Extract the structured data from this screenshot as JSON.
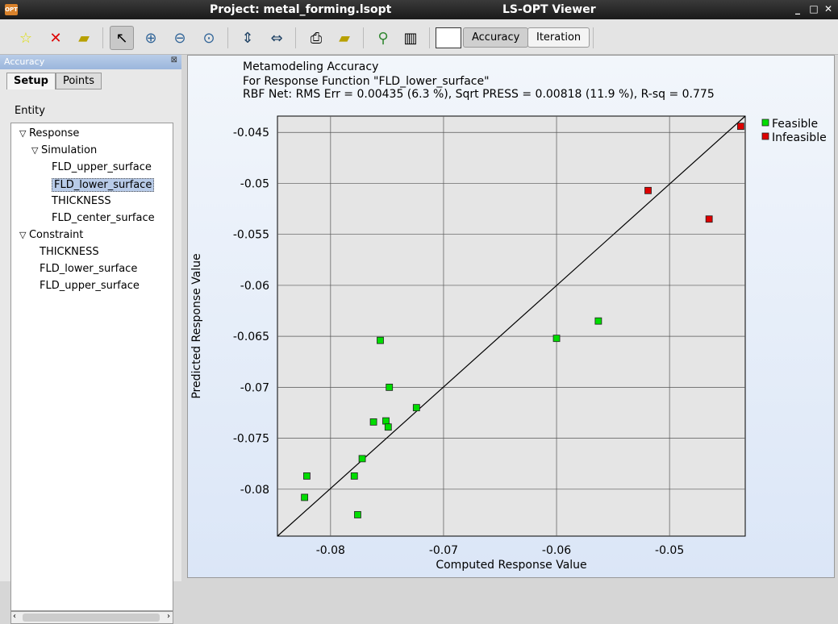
{
  "window": {
    "project_title": "Project: metal_forming.lsopt",
    "app_title": "LS-OPT Viewer",
    "app_icon_text": "OPT"
  },
  "toolbar": {
    "accuracy_label": "Accuracy",
    "iteration_label": "Iteration"
  },
  "left_panel": {
    "title": "Accuracy",
    "tabs": [
      "Setup",
      "Points"
    ],
    "entity_label": "Entity",
    "tree": [
      {
        "label": "Response",
        "level": 0,
        "expander": true
      },
      {
        "label": "Simulation",
        "level": 1,
        "expander": true
      },
      {
        "label": "FLD_upper_surface",
        "level": 2
      },
      {
        "label": "FLD_lower_surface",
        "level": 2,
        "selected": true
      },
      {
        "label": "THICKNESS",
        "level": 2
      },
      {
        "label": "FLD_center_surface",
        "level": 2
      },
      {
        "label": "Constraint",
        "level": 0,
        "expander": true
      },
      {
        "label": "THICKNESS",
        "level": 1
      },
      {
        "label": "FLD_lower_surface",
        "level": 1
      },
      {
        "label": "FLD_upper_surface",
        "level": 1
      }
    ]
  },
  "plot": {
    "title1": "Metamodeling Accuracy",
    "title2": "For Response Function \"FLD_lower_surface\"",
    "title3": "RBF Net: RMS Err = 0.00435 (6.3   %),  Sqrt PRESS = 0.00818 (11.9  %),  R-sq = 0.775"
  },
  "chart_data": {
    "type": "scatter",
    "xlabel": "Computed Response Value",
    "ylabel": "Predicted Response Value",
    "xlim": [
      -0.0847,
      -0.0433
    ],
    "ylim": [
      -0.0846,
      -0.0434
    ],
    "grid": true,
    "legend": "top-right",
    "xticks": [
      "-0.08",
      "-0.07",
      "-0.06",
      "-0.05"
    ],
    "xtick_values": [
      -0.08,
      -0.07,
      -0.06,
      -0.05
    ],
    "yticks": [
      "-0.045",
      "-0.05",
      "-0.055",
      "-0.06",
      "-0.065",
      "-0.07",
      "-0.075",
      "-0.08"
    ],
    "ytick_values": [
      -0.045,
      -0.05,
      -0.055,
      -0.06,
      -0.065,
      -0.07,
      -0.075,
      -0.08
    ],
    "diagonal": true,
    "series": [
      {
        "name": "Feasible",
        "color": "#00dd00",
        "points": [
          [
            -0.0823,
            -0.0808
          ],
          [
            -0.0821,
            -0.0787
          ],
          [
            -0.0776,
            -0.0825
          ],
          [
            -0.0779,
            -0.0787
          ],
          [
            -0.0772,
            -0.077
          ],
          [
            -0.0762,
            -0.0734
          ],
          [
            -0.0751,
            -0.0733
          ],
          [
            -0.0749,
            -0.0739
          ],
          [
            -0.0756,
            -0.0654
          ],
          [
            -0.0748,
            -0.07
          ],
          [
            -0.0724,
            -0.072
          ],
          [
            -0.06,
            -0.0652
          ],
          [
            -0.0563,
            -0.0635
          ]
        ]
      },
      {
        "name": "Infeasible",
        "color": "#dd0000",
        "points": [
          [
            -0.0519,
            -0.0507
          ],
          [
            -0.0465,
            -0.0535
          ],
          [
            -0.0437,
            -0.0444
          ]
        ]
      }
    ]
  }
}
